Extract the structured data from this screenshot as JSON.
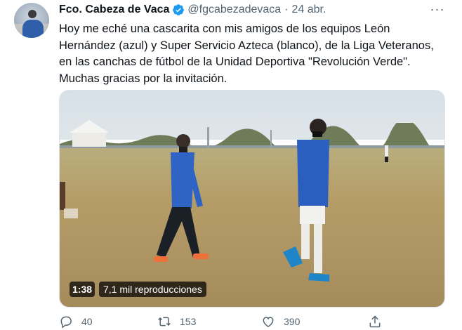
{
  "tweet": {
    "display_name": "Fco. Cabeza de Vaca",
    "handle": "@fgcabezadevaca",
    "separator": "·",
    "date": "24 abr.",
    "more_label": "···",
    "text_lines": [
      "Hoy me eché una cascarita con mis amigos de los equipos León",
      "Hernández (azul) y Super Servicio Azteca (blanco), de la Liga Veteranos,",
      "en las canchas de fútbol de la Unidad Deportiva \"Revolución Verde\".",
      "Muchas gracias por la invitación."
    ]
  },
  "video": {
    "duration": "1:38",
    "views": "7,1 mil reproducciones"
  },
  "actions": {
    "replies": "40",
    "retweets": "153",
    "likes": "390"
  },
  "icons": {
    "verified": "verified-badge-icon",
    "more": "more-options-icon",
    "reply": "reply-icon",
    "retweet": "retweet-icon",
    "like": "heart-icon",
    "share": "share-icon"
  },
  "colors": {
    "verified_blue": "#1d9bf0",
    "secondary_text": "#536471",
    "primary_text": "#0f1419"
  }
}
